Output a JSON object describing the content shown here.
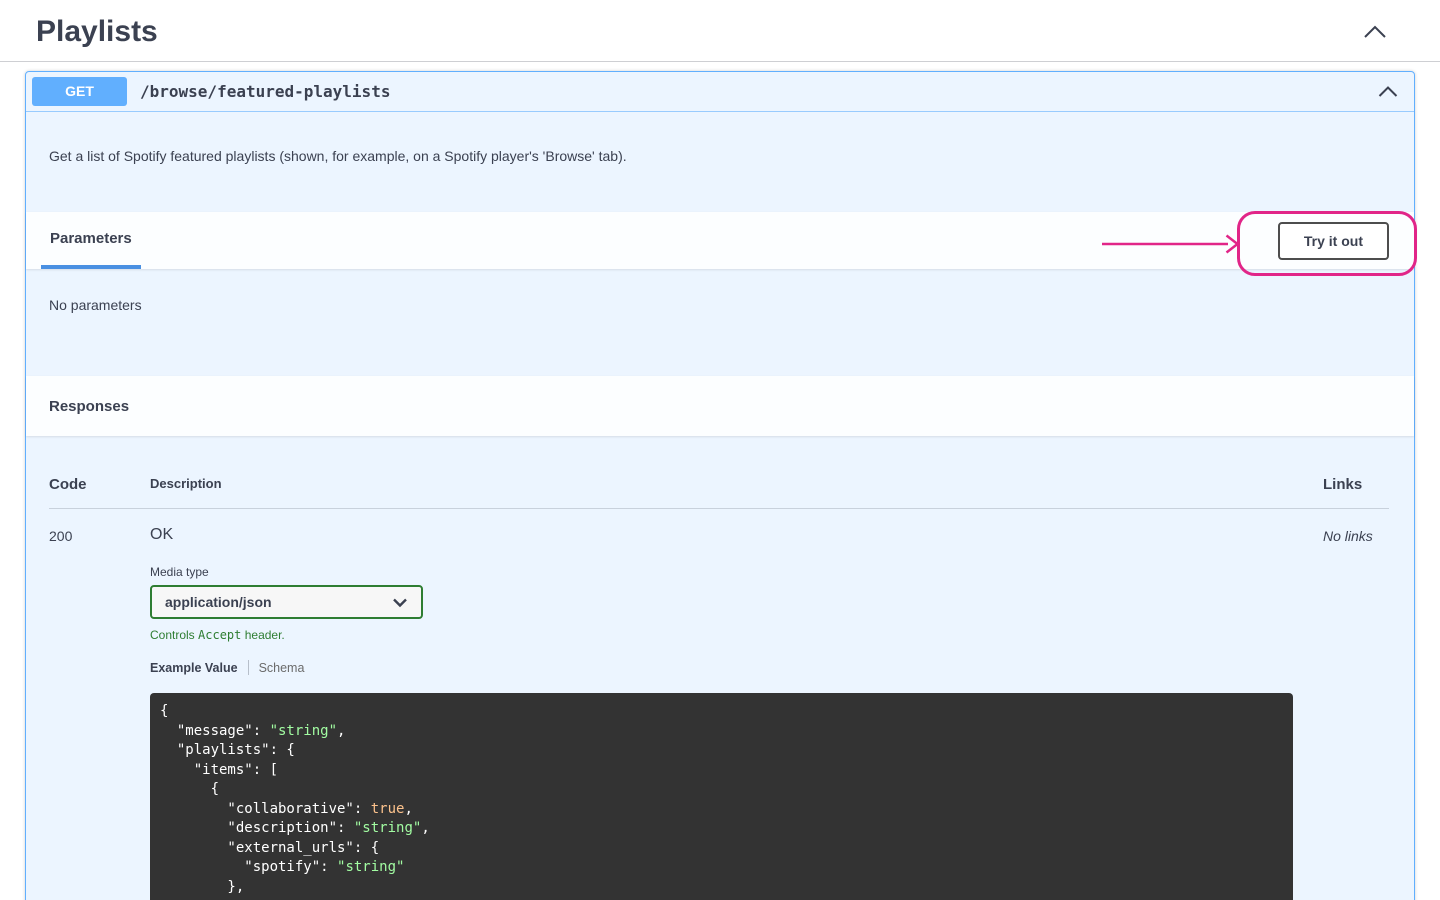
{
  "colors": {
    "method_get": "#61affe",
    "tab_underline": "#4990e2",
    "accept_green": "#2e7d32",
    "annotation": "#e12588",
    "text": "#3b4151"
  },
  "section": {
    "title": "Playlists"
  },
  "endpoint": {
    "method": "GET",
    "path": "/browse/featured-playlists",
    "description": "Get a list of Spotify featured playlists (shown, for example, on a Spotify player's 'Browse' tab)."
  },
  "parameters": {
    "tab_label": "Parameters",
    "try_it_out_label": "Try it out",
    "empty_message": "No parameters"
  },
  "responses": {
    "title": "Responses",
    "table": {
      "headers": [
        "Code",
        "Description",
        "Links"
      ],
      "rows": [
        {
          "code": "200",
          "description": "OK",
          "links": "No links"
        }
      ]
    },
    "media_type": {
      "label": "Media type",
      "selected": "application/json",
      "note_prefix": "Controls ",
      "note_code": "Accept",
      "note_suffix": " header."
    },
    "tabs": {
      "example": "Example Value",
      "schema": "Schema"
    },
    "example_code": {
      "token_colors": {
        "plain": "#ffffff",
        "string": "#a2fca2",
        "bool": "#fcc28c"
      },
      "lines": [
        [
          {
            "c": "plain",
            "t": "{"
          }
        ],
        [
          {
            "c": "plain",
            "t": "  \"message\": "
          },
          {
            "c": "string",
            "t": "\"string\""
          },
          {
            "c": "plain",
            "t": ","
          }
        ],
        [
          {
            "c": "plain",
            "t": "  \"playlists\": {"
          }
        ],
        [
          {
            "c": "plain",
            "t": "    \"items\": ["
          }
        ],
        [
          {
            "c": "plain",
            "t": "      {"
          }
        ],
        [
          {
            "c": "plain",
            "t": "        \"collaborative\": "
          },
          {
            "c": "bool",
            "t": "true"
          },
          {
            "c": "plain",
            "t": ","
          }
        ],
        [
          {
            "c": "plain",
            "t": "        \"description\": "
          },
          {
            "c": "string",
            "t": "\"string\""
          },
          {
            "c": "plain",
            "t": ","
          }
        ],
        [
          {
            "c": "plain",
            "t": "        \"external_urls\": {"
          }
        ],
        [
          {
            "c": "plain",
            "t": "          \"spotify\": "
          },
          {
            "c": "string",
            "t": "\"string\""
          }
        ],
        [
          {
            "c": "plain",
            "t": "        },"
          }
        ]
      ]
    }
  }
}
